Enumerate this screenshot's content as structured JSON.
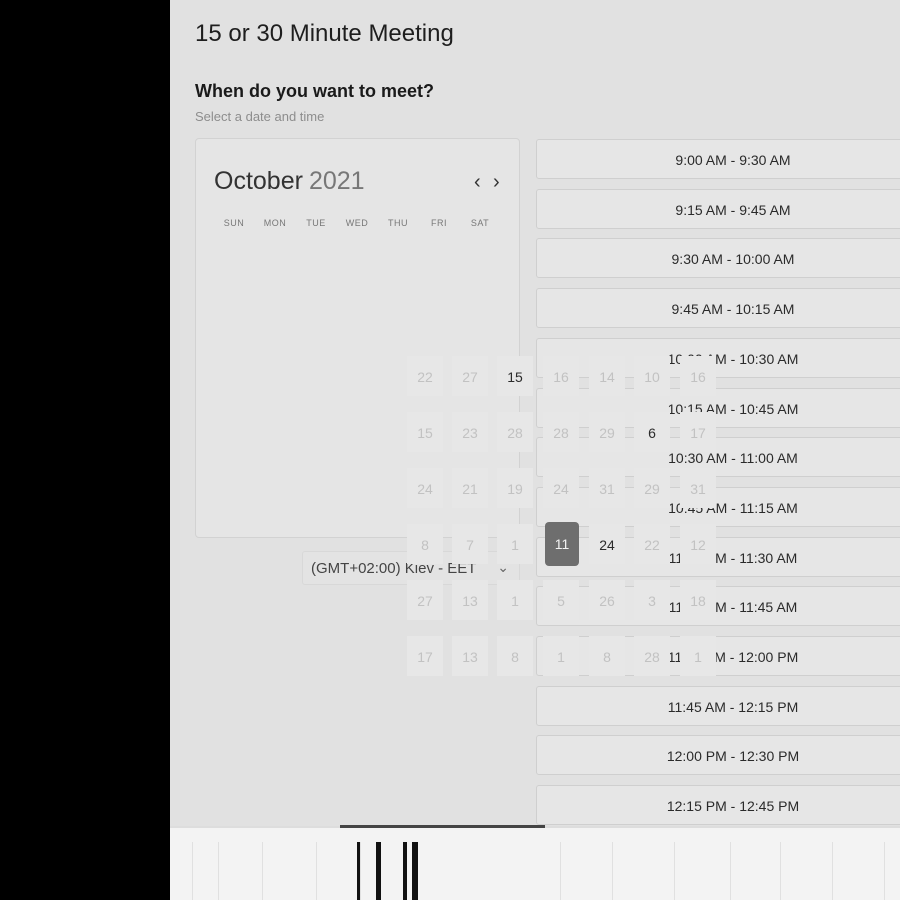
{
  "page": {
    "title": "15 or 30 Minute Meeting",
    "question": "When do you want to meet?",
    "helper": "Select a date and time"
  },
  "calendar": {
    "month": "October",
    "year": "2021",
    "prev_icon": "‹",
    "next_icon": "›",
    "weekdays": [
      "SUN",
      "MON",
      "TUE",
      "WED",
      "THU",
      "FRI",
      "SAT"
    ],
    "selected_day": "11",
    "scattered_days": [
      [
        "22",
        "27",
        "15",
        "16",
        "14",
        "10",
        "16"
      ],
      [
        "15",
        "23",
        "28",
        "28",
        "29",
        "6",
        "17"
      ],
      [
        "24",
        "21",
        "19",
        "24",
        "31",
        "29",
        "31"
      ],
      [
        "8",
        "7",
        "1",
        "",
        "24",
        "22",
        "12"
      ],
      [
        "27",
        "13",
        "1",
        "5",
        "26",
        "3",
        "18"
      ],
      [
        "17",
        "13",
        "8",
        "1",
        "8",
        "28",
        "1"
      ]
    ]
  },
  "timezone": {
    "value": "(GMT+02:00) Kiev - EET",
    "icon": "chevron-down"
  },
  "time_slots": [
    "9:00 AM - 9:30 AM",
    "9:15 AM - 9:45 AM",
    "9:30 AM - 10:00 AM",
    "9:45 AM - 10:15 AM",
    "10:00 AM - 10:30 AM",
    "10:15 AM - 10:45 AM",
    "10:30 AM - 11:00 AM",
    "10:45 AM - 11:15 AM",
    "11:00 AM - 11:30 AM",
    "11:15 AM - 11:45 AM",
    "11:30 AM - 12:00 PM",
    "11:45 AM - 12:15 PM",
    "12:00 PM - 12:30 PM",
    "12:15 PM - 12:45 PM"
  ],
  "colors": {
    "panel_bg": "#e1e1e1",
    "selected": "#6e6e6e"
  }
}
